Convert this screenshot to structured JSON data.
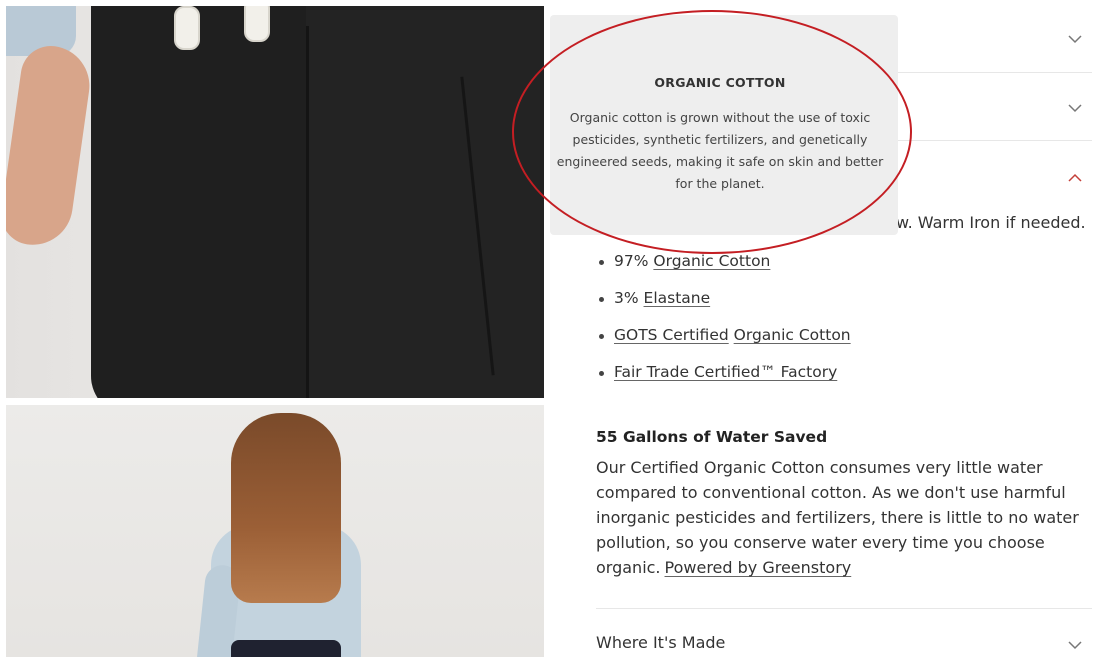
{
  "tooltip": {
    "title": "ORGANIC COTTON",
    "body": "Organic cotton is grown without the use of toxic pesticides, synthetic fertilizers, and genetically engineered seeds, making it safe on skin and better for the planet."
  },
  "care_text": "w. Warm Iron if needed.",
  "composition": [
    {
      "prefix": "97% ",
      "link": "Organic Cotton"
    },
    {
      "prefix": "3% ",
      "link": "Elastane"
    }
  ],
  "certifications": [
    {
      "link1": "GOTS Certified",
      "link2": "Organic Cotton"
    },
    {
      "link1": "Fair Trade Certified™ Factory"
    }
  ],
  "water": {
    "title": "55 Gallons of Water Saved",
    "body": "Our Certified Organic Cotton consumes very little water compared to conventional cotton. As we don't use harmful inorganic pesticides and fertilizers, there is little to no water pollution, so you conserve water every time you choose organic.",
    "powered_link": "Powered by Greenstory"
  },
  "sections": {
    "where_made": "Where It's Made"
  },
  "colors": {
    "annotation": "#c41e23",
    "chevron_expanded": "#c4403a",
    "chevron": "#777777"
  },
  "icons": [
    "chevron-down-icon",
    "chevron-up-icon"
  ]
}
